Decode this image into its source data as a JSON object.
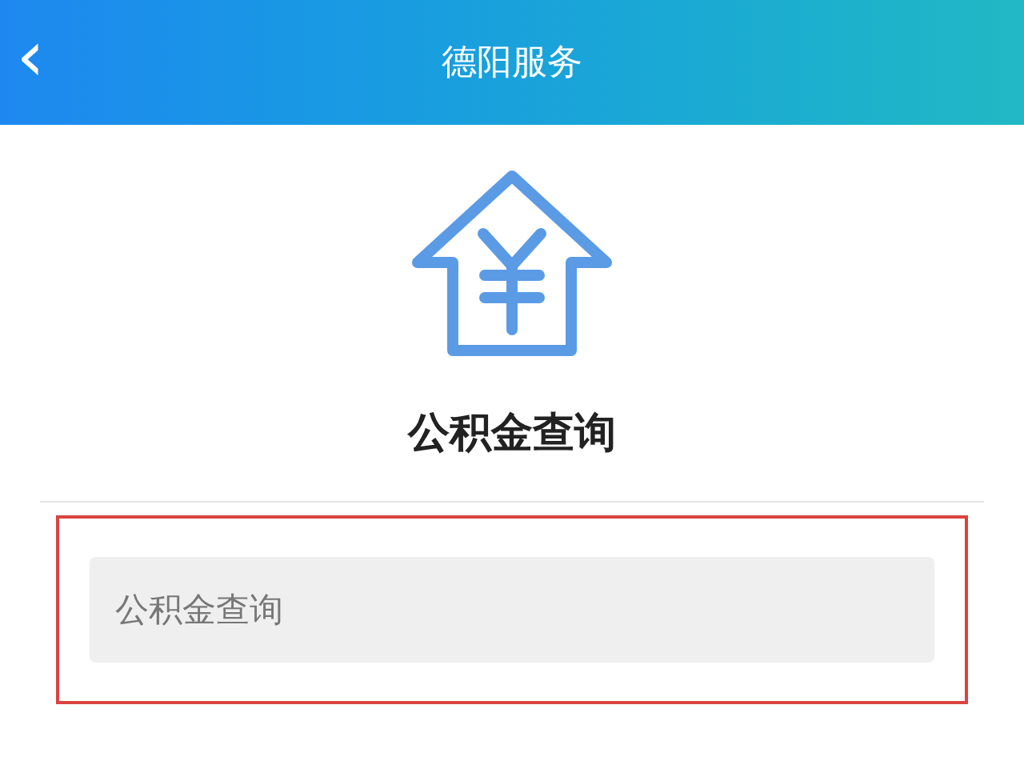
{
  "header": {
    "back": "‹",
    "title": "德阳服务"
  },
  "service": {
    "title": "公积金查询"
  },
  "search": {
    "placeholder": "公积金查询",
    "highlighted": true
  }
}
